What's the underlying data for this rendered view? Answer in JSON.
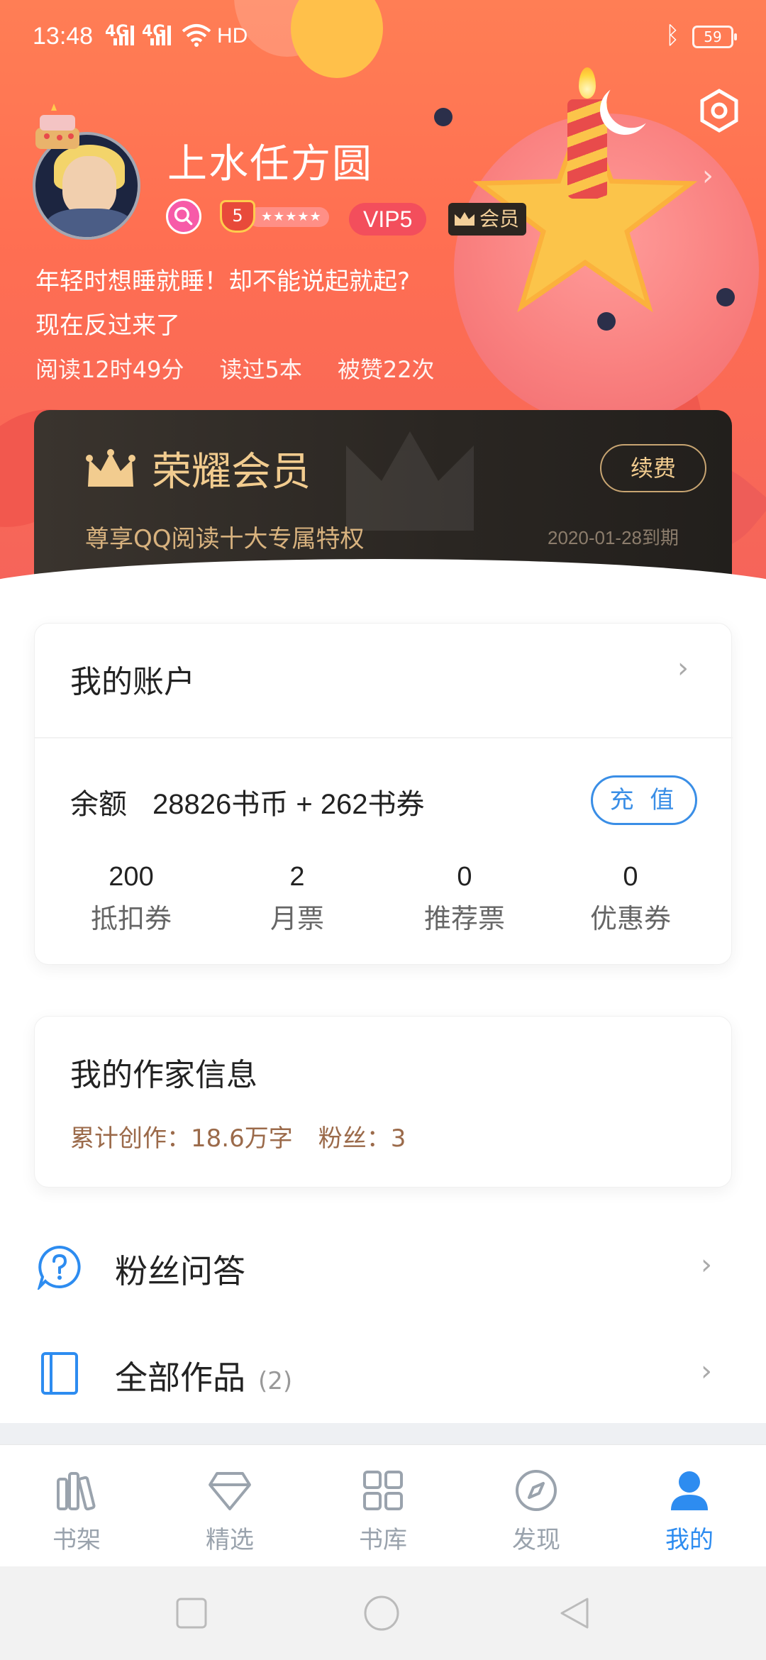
{
  "status_bar": {
    "time": "13:48",
    "network1": "4G",
    "network2": "4G",
    "hd": "HD",
    "battery": "59"
  },
  "profile": {
    "username": "上水任方圆",
    "level": "5",
    "level_stars": "★★★★★",
    "vip_badge": "VIP5",
    "member_badge": "会员",
    "bio_line1": "年轻时想睡就睡！却不能说起就起?",
    "bio_line2": "现在反过来了",
    "stats": {
      "read_time": "阅读12时49分",
      "books_read": "读过5本",
      "likes": "被赞22次"
    }
  },
  "vip_card": {
    "title": "荣耀会员",
    "subtitle": "尊享QQ阅读十大专属特权",
    "renew_label": "续费",
    "expiry": "2020-01-28到期"
  },
  "account": {
    "title": "我的账户",
    "balance_label": "余额",
    "balance_value": "28826书币 + 262书券",
    "recharge_label": "充 值",
    "stats": [
      {
        "value": "200",
        "label": "抵扣券"
      },
      {
        "value": "2",
        "label": "月票"
      },
      {
        "value": "0",
        "label": "推荐票"
      },
      {
        "value": "0",
        "label": "优惠券"
      }
    ]
  },
  "writer": {
    "title": "我的作家信息",
    "total_words": "累计创作：18.6万字",
    "fans": "粉丝：3"
  },
  "menu": [
    {
      "label": "粉丝问答",
      "icon": "question-icon"
    },
    {
      "label": "全部作品",
      "icon": "book-icon",
      "count": "(2)"
    }
  ],
  "tabs": [
    {
      "label": "书架",
      "icon": "bookshelf-icon"
    },
    {
      "label": "精选",
      "icon": "diamond-icon"
    },
    {
      "label": "书库",
      "icon": "grid-icon"
    },
    {
      "label": "发现",
      "icon": "compass-icon"
    },
    {
      "label": "我的",
      "icon": "person-icon",
      "active": true
    }
  ],
  "colors": {
    "accent_blue": "#2d8cf0",
    "header_orange": "#ff6f52",
    "vip_gold": "#f2cc8f",
    "writer_brown": "#9b6a4a"
  }
}
